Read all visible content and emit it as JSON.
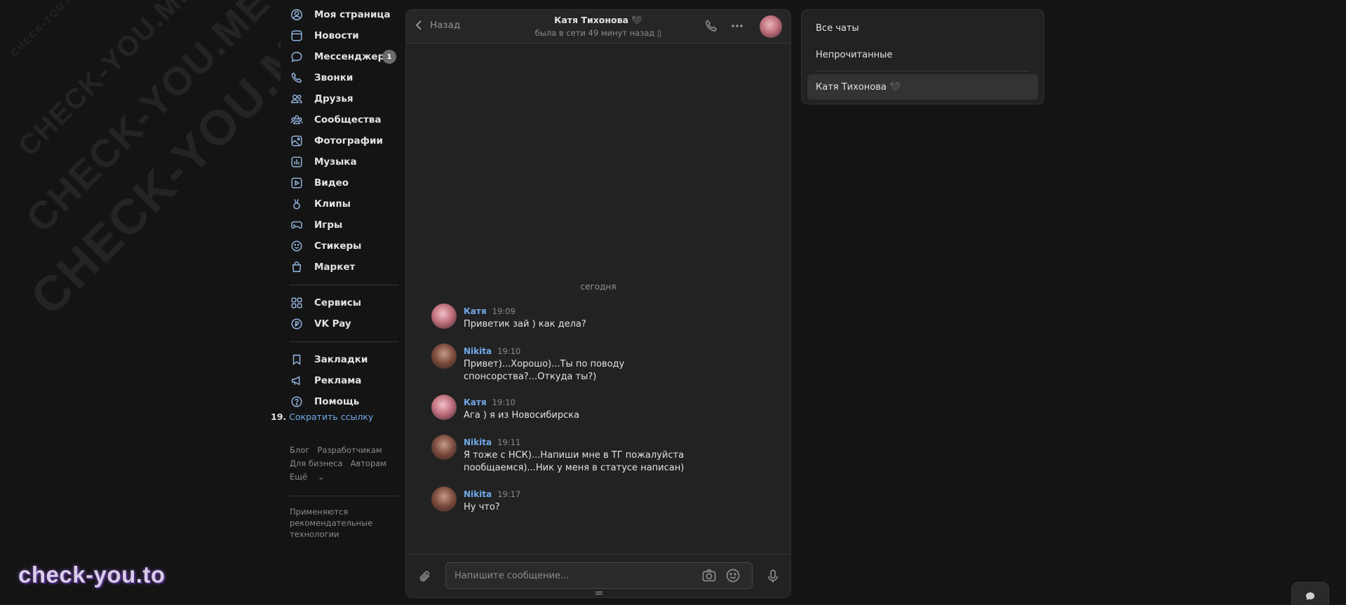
{
  "watermark": {
    "small": "CHECK-YOU.ME",
    "medium": "CHECK-YOU.ME",
    "large": "CHECK-YOU.ME",
    "xlarge": "CHECK-YOU.ME"
  },
  "brand_watermark": "check-you.to",
  "nav": {
    "group1": [
      {
        "label": "Моя страница",
        "icon": "user-circle-icon"
      },
      {
        "label": "Новости",
        "icon": "news-icon"
      },
      {
        "label": "Мессенджер",
        "icon": "message-icon",
        "badge": "1"
      },
      {
        "label": "Звонки",
        "icon": "phone-icon"
      },
      {
        "label": "Друзья",
        "icon": "friends-icon"
      },
      {
        "label": "Сообщества",
        "icon": "communities-icon"
      },
      {
        "label": "Фотографии",
        "icon": "photo-icon"
      },
      {
        "label": "Музыка",
        "icon": "music-icon"
      },
      {
        "label": "Видео",
        "icon": "video-icon"
      },
      {
        "label": "Клипы",
        "icon": "clips-icon"
      },
      {
        "label": "Игры",
        "icon": "gamepad-icon"
      },
      {
        "label": "Стикеры",
        "icon": "sticker-icon"
      },
      {
        "label": "Маркет",
        "icon": "market-bag-icon"
      }
    ],
    "group2": [
      {
        "label": "Сервисы",
        "icon": "services-grid-icon"
      },
      {
        "label": "VK Pay",
        "icon": "vkpay-icon"
      }
    ],
    "group3": [
      {
        "label": "Закладки",
        "icon": "bookmark-icon"
      },
      {
        "label": "Реклама",
        "icon": "megaphone-icon"
      },
      {
        "label": "Помощь",
        "icon": "help-icon"
      }
    ]
  },
  "short_link": {
    "number": "19.",
    "label": "Сократить ссылку"
  },
  "footer": {
    "blog": "Блог",
    "developers": "Разработчикам",
    "business": "Для бизнеса",
    "authors": "Авторам",
    "more": "Ещё",
    "note": "Применяются рекомендательные технологии"
  },
  "chat": {
    "back_label": "Назад",
    "peer_name": "Катя Тихонова 🖤",
    "peer_status": "была в сети 49 минут назад",
    "date_separator": "сегодня",
    "messages": [
      {
        "author": "Катя",
        "time": "19:09",
        "text": "Приветик зай ) как дела?"
      },
      {
        "author": "Nikita",
        "time": "19:10",
        "text": "Привет)...Хорошо)...Ты по поводу спонсорства?...Откуда ты?)"
      },
      {
        "author": "Катя",
        "time": "19:10",
        "text": "Ага ) я из Новосибирска"
      },
      {
        "author": "Nikita",
        "time": "19:11",
        "text": "Я тоже с НСК)...Напиши мне в ТГ пожалуйста пообщаемся)...Ник у меня в статусе написан)"
      },
      {
        "author": "Nikita",
        "time": "19:17",
        "text": "Ну что?"
      }
    ],
    "composer_placeholder": "Напишите сообщение..."
  },
  "folders": {
    "all": "Все чаты",
    "unread": "Непрочитанные",
    "custom": "Катя Тихонова 🖤"
  }
}
